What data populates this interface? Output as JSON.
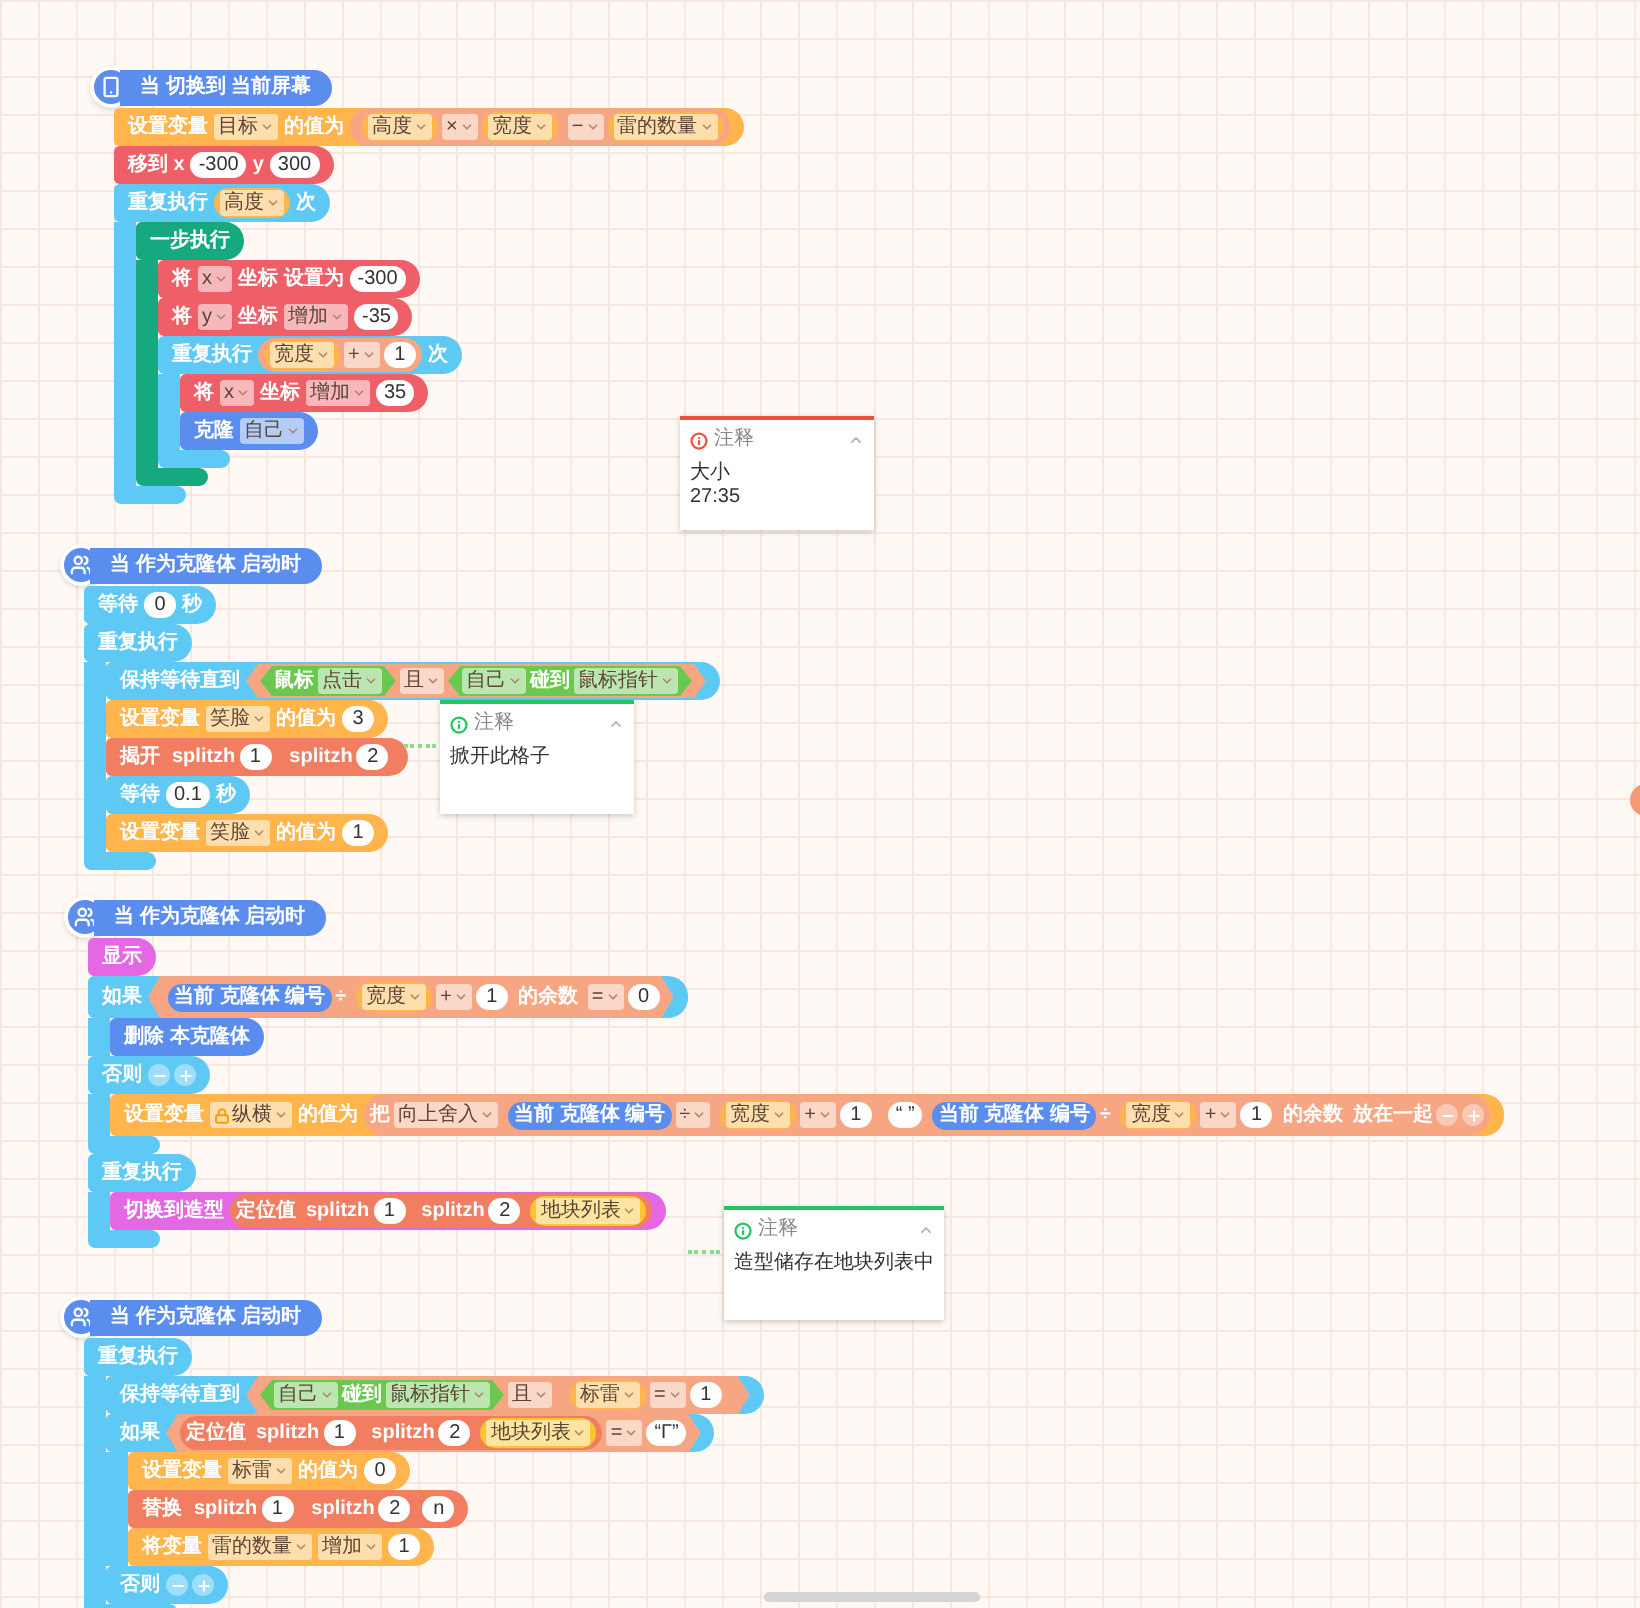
{
  "scripts": [
    {
      "hat": {
        "kind": "screen",
        "text": "当 切换到 当前屏幕"
      },
      "blocks": [
        {
          "kind": "stack",
          "color": "#ffb54c",
          "parts": [
            {
              "kind": "text",
              "text": "设置变量"
            },
            {
              "kind": "dropdown",
              "text": "目标"
            },
            {
              "kind": "text",
              "text": "的值为"
            },
            {
              "kind": "reporter",
              "color": "#f6a683",
              "parts": [
                {
                  "kind": "reporter",
                  "color": "#f6a683",
                  "parts": [
                    {
                      "kind": "reporter",
                      "color": "#ffb54c",
                      "parts": [
                        {
                          "kind": "dropdown",
                          "text": "高度"
                        }
                      ]
                    },
                    {
                      "kind": "dropdown",
                      "text": "×"
                    },
                    {
                      "kind": "reporter",
                      "color": "#ffb54c",
                      "parts": [
                        {
                          "kind": "dropdown",
                          "text": "宽度"
                        }
                      ]
                    }
                  ]
                },
                {
                  "kind": "dropdown",
                  "text": "−"
                },
                {
                  "kind": "reporter",
                  "color": "#ffb54c",
                  "parts": [
                    {
                      "kind": "dropdown",
                      "text": "雷的数量"
                    }
                  ]
                }
              ]
            }
          ]
        },
        {
          "kind": "stack",
          "color": "#ef5f67",
          "parts": [
            {
              "kind": "text",
              "text": "移到 x"
            },
            {
              "kind": "number",
              "text": "-300"
            },
            {
              "kind": "text",
              "text": "y"
            },
            {
              "kind": "number",
              "text": "300"
            }
          ]
        },
        {
          "kind": "c",
          "color": "#5fc9f6",
          "sections": [
            {
              "parts": [
                {
                  "kind": "text",
                  "text": "重复执行"
                },
                {
                  "kind": "reporter",
                  "color": "#ffb54c",
                  "parts": [
                    {
                      "kind": "dropdown",
                      "text": "高度"
                    }
                  ]
                },
                {
                  "kind": "text",
                  "text": "次"
                }
              ],
              "children": [
                {
                  "kind": "c",
                  "color": "#16a97f",
                  "sections": [
                    {
                      "parts": [
                        {
                          "kind": "text",
                          "text": "一步执行"
                        }
                      ],
                      "children": [
                        {
                          "kind": "stack",
                          "color": "#ef5f67",
                          "parts": [
                            {
                              "kind": "text",
                              "text": "将"
                            },
                            {
                              "kind": "dropdown",
                              "text": "x"
                            },
                            {
                              "kind": "text",
                              "text": "坐标 设置为"
                            },
                            {
                              "kind": "number",
                              "text": "-300"
                            }
                          ]
                        },
                        {
                          "kind": "stack",
                          "color": "#ef5f67",
                          "parts": [
                            {
                              "kind": "text",
                              "text": "将"
                            },
                            {
                              "kind": "dropdown",
                              "text": "y"
                            },
                            {
                              "kind": "text",
                              "text": "坐标"
                            },
                            {
                              "kind": "dropdown",
                              "text": "增加"
                            },
                            {
                              "kind": "number",
                              "text": "-35"
                            }
                          ]
                        },
                        {
                          "kind": "c",
                          "color": "#5fc9f6",
                          "sections": [
                            {
                              "parts": [
                                {
                                  "kind": "text",
                                  "text": "重复执行"
                                },
                                {
                                  "kind": "reporter",
                                  "color": "#f6a683",
                                  "parts": [
                                    {
                                      "kind": "reporter",
                                      "color": "#ffb54c",
                                      "parts": [
                                        {
                                          "kind": "dropdown",
                                          "text": "宽度"
                                        }
                                      ]
                                    },
                                    {
                                      "kind": "dropdown",
                                      "text": "+"
                                    },
                                    {
                                      "kind": "number",
                                      "text": "1"
                                    }
                                  ]
                                },
                                {
                                  "kind": "text",
                                  "text": "次"
                                }
                              ],
                              "children": [
                                {
                                  "kind": "stack",
                                  "color": "#ef5f67",
                                  "parts": [
                                    {
                                      "kind": "text",
                                      "text": "将"
                                    },
                                    {
                                      "kind": "dropdown",
                                      "text": "x"
                                    },
                                    {
                                      "kind": "text",
                                      "text": "坐标"
                                    },
                                    {
                                      "kind": "dropdown",
                                      "text": "增加"
                                    },
                                    {
                                      "kind": "number",
                                      "text": "35"
                                    }
                                  ]
                                },
                                {
                                  "kind": "stack",
                                  "color": "#5b8def",
                                  "parts": [
                                    {
                                      "kind": "text",
                                      "text": "克隆"
                                    },
                                    {
                                      "kind": "dropdown",
                                      "text": "自己"
                                    }
                                  ]
                                }
                              ]
                            }
                          ]
                        }
                      ]
                    }
                  ]
                }
              ]
            }
          ]
        }
      ]
    },
    {
      "hat": {
        "kind": "clone",
        "text": "当 作为克隆体 启动时"
      },
      "blocks": [
        {
          "kind": "stack",
          "color": "#5fc9f6",
          "parts": [
            {
              "kind": "text",
              "text": "等待"
            },
            {
              "kind": "number",
              "text": "0"
            },
            {
              "kind": "text",
              "text": "秒"
            }
          ]
        },
        {
          "kind": "c",
          "color": "#5fc9f6",
          "sections": [
            {
              "parts": [
                {
                  "kind": "text",
                  "text": "重复执行"
                }
              ],
              "children": [
                {
                  "kind": "stack",
                  "color": "#5fc9f6",
                  "parts": [
                    {
                      "kind": "text",
                      "text": "保持等待直到"
                    },
                    {
                      "kind": "bool",
                      "color": "#f6a683",
                      "parts": [
                        {
                          "kind": "bool",
                          "color": "#6bc84e",
                          "parts": [
                            {
                              "kind": "text",
                              "text": "鼠标"
                            },
                            {
                              "kind": "dropdown",
                              "text": "点击"
                            }
                          ]
                        },
                        {
                          "kind": "dropdown",
                          "text": "且"
                        },
                        {
                          "kind": "bool",
                          "color": "#6bc84e",
                          "parts": [
                            {
                              "kind": "dropdown",
                              "text": "自己"
                            },
                            {
                              "kind": "text",
                              "text": "碰到"
                            },
                            {
                              "kind": "dropdown",
                              "text": "鼠标指针"
                            }
                          ]
                        }
                      ]
                    }
                  ]
                },
                {
                  "kind": "stack",
                  "color": "#ffb54c",
                  "parts": [
                    {
                      "kind": "text",
                      "text": "设置变量"
                    },
                    {
                      "kind": "dropdown",
                      "text": "笑脸"
                    },
                    {
                      "kind": "text",
                      "text": "的值为"
                    },
                    {
                      "kind": "number",
                      "text": "3"
                    }
                  ]
                },
                {
                  "kind": "stack",
                  "color": "#f27e61",
                  "parts": [
                    {
                      "kind": "text",
                      "text": "揭开"
                    },
                    {
                      "kind": "reporter",
                      "color": "#f27e61",
                      "parts": [
                        {
                          "kind": "text",
                          "text": "splitzh"
                        },
                        {
                          "kind": "number",
                          "text": "1"
                        }
                      ]
                    },
                    {
                      "kind": "reporter",
                      "color": "#f27e61",
                      "parts": [
                        {
                          "kind": "text",
                          "text": "splitzh"
                        },
                        {
                          "kind": "number",
                          "text": "2"
                        }
                      ]
                    }
                  ]
                },
                {
                  "kind": "stack",
                  "color": "#5fc9f6",
                  "parts": [
                    {
                      "kind": "text",
                      "text": "等待"
                    },
                    {
                      "kind": "number",
                      "text": "0.1"
                    },
                    {
                      "kind": "text",
                      "text": "秒"
                    }
                  ]
                },
                {
                  "kind": "stack",
                  "color": "#ffb54c",
                  "parts": [
                    {
                      "kind": "text",
                      "text": "设置变量"
                    },
                    {
                      "kind": "dropdown",
                      "text": "笑脸"
                    },
                    {
                      "kind": "text",
                      "text": "的值为"
                    },
                    {
                      "kind": "number",
                      "text": "1"
                    }
                  ]
                }
              ]
            }
          ]
        }
      ]
    },
    {
      "hat": {
        "kind": "clone",
        "text": "当 作为克隆体 启动时"
      },
      "blocks": [
        {
          "kind": "stack",
          "color": "#e467e3",
          "parts": [
            {
              "kind": "text",
              "text": "显示"
            }
          ]
        },
        {
          "kind": "c",
          "color": "#5fc9f6",
          "sections": [
            {
              "parts": [
                {
                  "kind": "text",
                  "text": "如果"
                },
                {
                  "kind": "bool",
                  "color": "#f6a683",
                  "parts": [
                    {
                      "kind": "reporter",
                      "color": "#f6a683",
                      "parts": [
                        {
                          "kind": "reporter",
                          "color": "#5b8def",
                          "parts": [
                            {
                              "kind": "text",
                              "text": "当前 克隆体 编号"
                            }
                          ]
                        },
                        {
                          "kind": "text",
                          "text": "÷"
                        },
                        {
                          "kind": "reporter",
                          "color": "#f6a683",
                          "parts": [
                            {
                              "kind": "reporter",
                              "color": "#ffb54c",
                              "parts": [
                                {
                                  "kind": "dropdown",
                                  "text": "宽度"
                                }
                              ]
                            },
                            {
                              "kind": "dropdown",
                              "text": "+"
                            },
                            {
                              "kind": "number",
                              "text": "1"
                            }
                          ]
                        },
                        {
                          "kind": "text",
                          "text": "的余数"
                        }
                      ]
                    },
                    {
                      "kind": "dropdown",
                      "text": "="
                    },
                    {
                      "kind": "number",
                      "text": "0"
                    }
                  ]
                }
              ],
              "children": [
                {
                  "kind": "stack",
                  "color": "#5b8def",
                  "parts": [
                    {
                      "kind": "text",
                      "text": "删除 本克隆体"
                    }
                  ]
                }
              ]
            },
            {
              "parts": [
                {
                  "kind": "text",
                  "text": "否则"
                },
                {
                  "kind": "pm"
                }
              ],
              "children": [
                {
                  "kind": "stack",
                  "color": "#ffb54c",
                  "parts": [
                    {
                      "kind": "text",
                      "text": "设置变量"
                    },
                    {
                      "kind": "dropdown",
                      "text": "纵横",
                      "locked": true
                    },
                    {
                      "kind": "text",
                      "text": "的值为"
                    },
                    {
                      "kind": "reporter",
                      "color": "#f6a683",
                      "parts": [
                        {
                          "kind": "text",
                          "text": "把"
                        },
                        {
                          "kind": "dropdown",
                          "text": "向上舍入"
                        },
                        {
                          "kind": "reporter",
                          "color": "#f6a683",
                          "parts": [
                            {
                              "kind": "reporter",
                              "color": "#5b8def",
                              "parts": [
                                {
                                  "kind": "text",
                                  "text": "当前 克隆体 编号"
                                }
                              ]
                            },
                            {
                              "kind": "dropdown",
                              "text": "÷"
                            },
                            {
                              "kind": "reporter",
                              "color": "#f6a683",
                              "parts": [
                                {
                                  "kind": "reporter",
                                  "color": "#ffb54c",
                                  "parts": [
                                    {
                                      "kind": "dropdown",
                                      "text": "宽度"
                                    }
                                  ]
                                },
                                {
                                  "kind": "dropdown",
                                  "text": "+"
                                },
                                {
                                  "kind": "number",
                                  "text": "1"
                                }
                              ]
                            }
                          ]
                        },
                        {
                          "kind": "number",
                          "text": "“ ”"
                        },
                        {
                          "kind": "reporter",
                          "color": "#f6a683",
                          "parts": [
                            {
                              "kind": "reporter",
                              "color": "#5b8def",
                              "parts": [
                                {
                                  "kind": "text",
                                  "text": "当前 克隆体 编号"
                                }
                              ]
                            },
                            {
                              "kind": "text",
                              "text": "÷"
                            },
                            {
                              "kind": "reporter",
                              "color": "#f6a683",
                              "parts": [
                                {
                                  "kind": "reporter",
                                  "color": "#ffb54c",
                                  "parts": [
                                    {
                                      "kind": "dropdown",
                                      "text": "宽度"
                                    }
                                  ]
                                },
                                {
                                  "kind": "dropdown",
                                  "text": "+"
                                },
                                {
                                  "kind": "number",
                                  "text": "1"
                                }
                              ]
                            },
                            {
                              "kind": "text",
                              "text": "的余数"
                            }
                          ]
                        },
                        {
                          "kind": "text",
                          "text": "放在一起"
                        },
                        {
                          "kind": "pm"
                        }
                      ]
                    }
                  ]
                }
              ]
            }
          ]
        },
        {
          "kind": "c",
          "color": "#5fc9f6",
          "sections": [
            {
              "parts": [
                {
                  "kind": "text",
                  "text": "重复执行"
                }
              ],
              "children": [
                {
                  "kind": "stack",
                  "color": "#e467e3",
                  "parts": [
                    {
                      "kind": "text",
                      "text": "切换到造型"
                    },
                    {
                      "kind": "reporter",
                      "color": "#f27e61",
                      "parts": [
                        {
                          "kind": "text",
                          "text": "定位值"
                        },
                        {
                          "kind": "reporter",
                          "color": "#f27e61",
                          "parts": [
                            {
                              "kind": "text",
                              "text": "splitzh"
                            },
                            {
                              "kind": "number",
                              "text": "1"
                            }
                          ]
                        },
                        {
                          "kind": "reporter",
                          "color": "#f27e61",
                          "parts": [
                            {
                              "kind": "text",
                              "text": "splitzh"
                            },
                            {
                              "kind": "number",
                              "text": "2"
                            }
                          ]
                        },
                        {
                          "kind": "reporter",
                          "color": "#fbc52e",
                          "parts": [
                            {
                              "kind": "dropdown",
                              "text": "地块列表"
                            }
                          ]
                        }
                      ]
                    }
                  ]
                }
              ]
            }
          ]
        }
      ]
    },
    {
      "hat": {
        "kind": "clone",
        "text": "当 作为克隆体 启动时"
      },
      "blocks": [
        {
          "kind": "c",
          "color": "#5fc9f6",
          "sections": [
            {
              "parts": [
                {
                  "kind": "text",
                  "text": "重复执行"
                }
              ],
              "children": [
                {
                  "kind": "stack",
                  "color": "#5fc9f6",
                  "parts": [
                    {
                      "kind": "text",
                      "text": "保持等待直到"
                    },
                    {
                      "kind": "bool",
                      "color": "#f6a683",
                      "parts": [
                        {
                          "kind": "bool",
                          "color": "#6bc84e",
                          "parts": [
                            {
                              "kind": "dropdown",
                              "text": "自己"
                            },
                            {
                              "kind": "text",
                              "text": "碰到"
                            },
                            {
                              "kind": "dropdown",
                              "text": "鼠标指针"
                            }
                          ]
                        },
                        {
                          "kind": "dropdown",
                          "text": "且"
                        },
                        {
                          "kind": "bool",
                          "color": "#f6a683",
                          "parts": [
                            {
                              "kind": "reporter",
                              "color": "#ffb54c",
                              "parts": [
                                {
                                  "kind": "dropdown",
                                  "text": "标雷"
                                }
                              ]
                            },
                            {
                              "kind": "dropdown",
                              "text": "="
                            },
                            {
                              "kind": "number",
                              "text": "1"
                            }
                          ]
                        }
                      ]
                    }
                  ]
                },
                {
                  "kind": "c",
                  "color": "#5fc9f6",
                  "sections": [
                    {
                      "parts": [
                        {
                          "kind": "text",
                          "text": "如果"
                        },
                        {
                          "kind": "bool",
                          "color": "#f6a683",
                          "parts": [
                            {
                              "kind": "reporter",
                              "color": "#f27e61",
                              "parts": [
                                {
                                  "kind": "text",
                                  "text": "定位值"
                                },
                                {
                                  "kind": "reporter",
                                  "color": "#f27e61",
                                  "parts": [
                                    {
                                      "kind": "text",
                                      "text": "splitzh"
                                    },
                                    {
                                      "kind": "number",
                                      "text": "1"
                                    }
                                  ]
                                },
                                {
                                  "kind": "reporter",
                                  "color": "#f27e61",
                                  "parts": [
                                    {
                                      "kind": "text",
                                      "text": "splitzh"
                                    },
                                    {
                                      "kind": "number",
                                      "text": "2"
                                    }
                                  ]
                                },
                                {
                                  "kind": "reporter",
                                  "color": "#fbc52e",
                                  "parts": [
                                    {
                                      "kind": "dropdown",
                                      "text": "地块列表"
                                    }
                                  ]
                                }
                              ]
                            },
                            {
                              "kind": "dropdown",
                              "text": "="
                            },
                            {
                              "kind": "number",
                              "text": "“Γ”"
                            }
                          ]
                        }
                      ],
                      "children": [
                        {
                          "kind": "stack",
                          "color": "#ffb54c",
                          "parts": [
                            {
                              "kind": "text",
                              "text": "设置变量"
                            },
                            {
                              "kind": "dropdown",
                              "text": "标雷"
                            },
                            {
                              "kind": "text",
                              "text": "的值为"
                            },
                            {
                              "kind": "number",
                              "text": "0"
                            }
                          ]
                        },
                        {
                          "kind": "stack",
                          "color": "#f27e61",
                          "parts": [
                            {
                              "kind": "text",
                              "text": "替换"
                            },
                            {
                              "kind": "reporter",
                              "color": "#f27e61",
                              "parts": [
                                {
                                  "kind": "text",
                                  "text": "splitzh"
                                },
                                {
                                  "kind": "number",
                                  "text": "1"
                                }
                              ]
                            },
                            {
                              "kind": "reporter",
                              "color": "#f27e61",
                              "parts": [
                                {
                                  "kind": "text",
                                  "text": "splitzh"
                                },
                                {
                                  "kind": "number",
                                  "text": "2"
                                }
                              ]
                            },
                            {
                              "kind": "number",
                              "text": "n"
                            }
                          ]
                        },
                        {
                          "kind": "stack",
                          "color": "#ffb54c",
                          "parts": [
                            {
                              "kind": "text",
                              "text": "将变量"
                            },
                            {
                              "kind": "dropdown",
                              "text": "雷的数量"
                            },
                            {
                              "kind": "dropdown",
                              "text": "增加"
                            },
                            {
                              "kind": "number",
                              "text": "1"
                            }
                          ]
                        }
                      ]
                    },
                    {
                      "parts": [
                        {
                          "kind": "text",
                          "text": "否则"
                        },
                        {
                          "kind": "pm"
                        }
                      ]
                    }
                  ]
                }
              ]
            }
          ]
        }
      ]
    }
  ],
  "comments": [
    {
      "title": "注释",
      "lines": [
        "大小",
        "27:35"
      ],
      "color": "#f0503c",
      "attached": false
    },
    {
      "title": "注释",
      "lines": [
        "掀开此格子"
      ],
      "color": "#22c55e",
      "attached": true
    },
    {
      "title": "注释",
      "lines": [
        "造型储存在地块列表中"
      ],
      "color": "#22c55e",
      "attached": true
    }
  ]
}
